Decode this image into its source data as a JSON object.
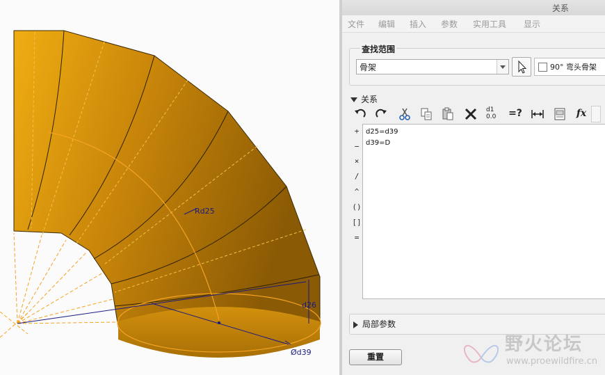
{
  "viewport": {
    "dimensions": {
      "radius_label": "Rd25",
      "height_label": "d26",
      "diameter_label": "Ød39"
    },
    "model_color": "#c98a08"
  },
  "dialog": {
    "title": "关系",
    "menu": [
      "文件",
      "编辑",
      "插入",
      "参数",
      "实用工具",
      "显示"
    ],
    "scope": {
      "label": "查找范围",
      "selected": "骨架",
      "model_name": "90° 弯头骨架"
    },
    "relations": {
      "label": "关系",
      "toolbar": [
        {
          "icon": "undo-icon"
        },
        {
          "icon": "redo-icon"
        },
        {
          "icon": "cut-icon"
        },
        {
          "icon": "copy-icon"
        },
        {
          "icon": "paste-icon"
        },
        {
          "icon": "delete-icon"
        },
        {
          "icon": "show-values-icon",
          "top": "d1",
          "bottom": "0.0"
        },
        {
          "icon": "verify-icon",
          "text": "=?"
        },
        {
          "icon": "dimension-icon"
        },
        {
          "icon": "sort-icon"
        },
        {
          "icon": "function-icon",
          "text": "fx"
        }
      ],
      "operators": [
        "+",
        "−",
        "×",
        "/",
        "^",
        "()",
        "[]",
        "="
      ],
      "lines": [
        "d25=d39",
        "d39=D"
      ]
    },
    "local_params_label": "局部参数",
    "reset_label": "重置"
  },
  "watermark": {
    "title": "野火论坛",
    "url": "www.proewildfire.cn"
  }
}
